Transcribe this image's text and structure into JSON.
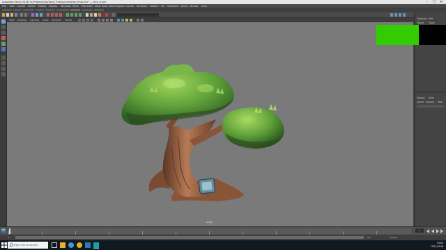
{
  "window": {
    "title": "Autodesk Maya 2018: D:\\Projects\\Stylized_Tree\\scenes\\tree_final.mb* --- tree_trunk",
    "min_glyph": "–",
    "max_glyph": "□",
    "close_glyph": "✕"
  },
  "menubar": {
    "items": [
      "File",
      "Edit",
      "Create",
      "Select",
      "Modify",
      "Display",
      "Windows",
      "Mesh",
      "Edit Mesh",
      "Mesh Tools",
      "Mesh Display",
      "Curves",
      "Surfaces",
      "Deform",
      "UV",
      "Generate",
      "Cache",
      "Arnold",
      "Help"
    ]
  },
  "panel_menu": {
    "items": [
      "View",
      "Shading",
      "Lighting",
      "Show",
      "Renderer",
      "Panels"
    ]
  },
  "viewport": {
    "background": "#7a7a7a",
    "camera_label": "persp"
  },
  "right_panel": {
    "tabs": [
      "Channels",
      "Edit",
      "Object",
      "Show"
    ],
    "layer_tabs": [
      "Display",
      "Anim"
    ],
    "layer_menu": [
      "Layers",
      "Options",
      "Help"
    ]
  },
  "overlays": {
    "green": "#33cc00",
    "black": "#000000"
  },
  "timeslider": {
    "start": "1",
    "end": "120",
    "current": "1"
  },
  "range": {
    "start": "1",
    "end": "120",
    "fps": "24 fps"
  },
  "mel_label": "MEL",
  "taskbar": {
    "search_placeholder": "Type here to search",
    "time": "13:02",
    "date": "13/11/2018"
  }
}
